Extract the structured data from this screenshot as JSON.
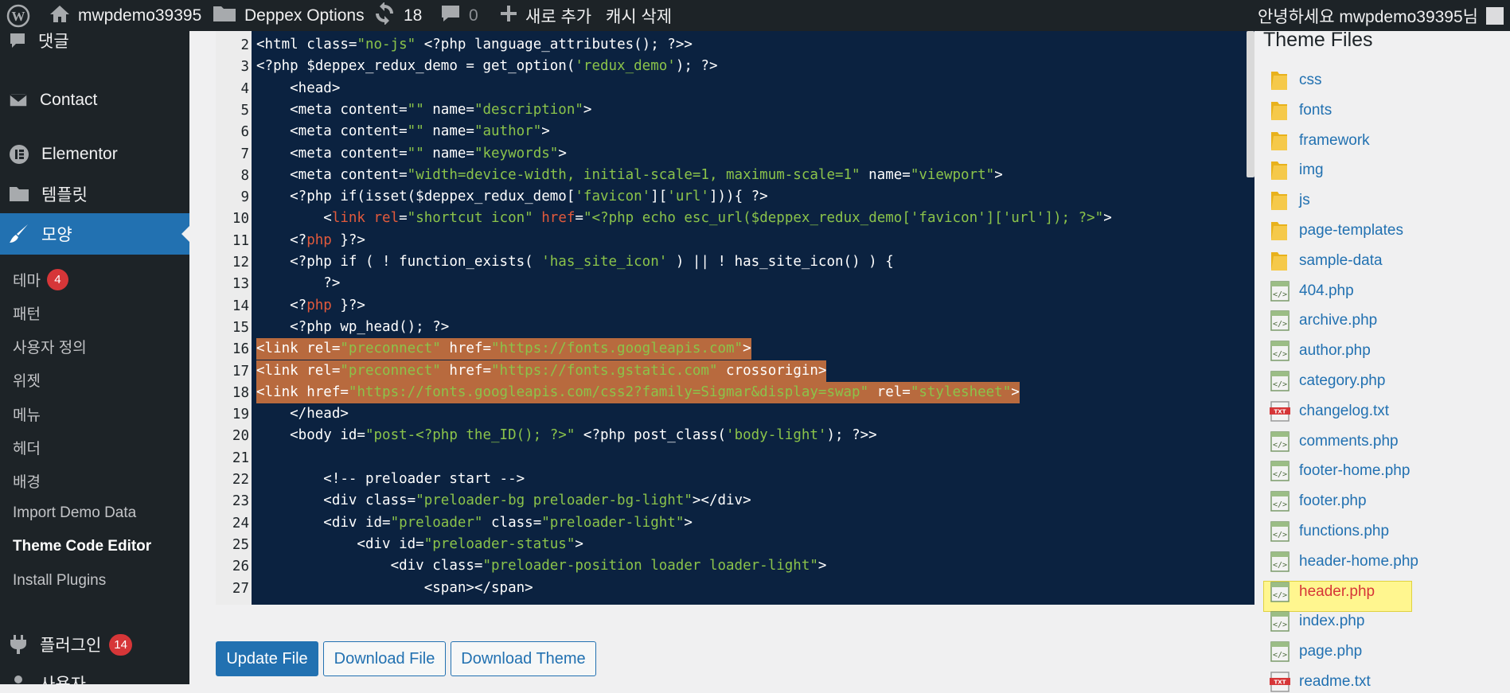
{
  "admin_bar": {
    "site_name": "mwpdemo39395",
    "options_label": "Deppex Options",
    "updates_count": "18",
    "comments_count": "0",
    "new_label": "새로 추가",
    "cache_label": "캐시 삭제",
    "greeting": "안녕하세요 mwpdemo39395님"
  },
  "sidebar": {
    "items": [
      {
        "label": "댓글",
        "icon": "comments-icon"
      },
      {
        "label": "Contact",
        "icon": "mail-icon"
      },
      {
        "label": "Elementor",
        "icon": "elementor-icon"
      },
      {
        "label": "템플릿",
        "icon": "folder-icon"
      },
      {
        "label": "모양",
        "icon": "paintbrush-icon"
      }
    ],
    "submenu": [
      {
        "label": "테마",
        "badge": "4"
      },
      {
        "label": "패턴"
      },
      {
        "label": "사용자 정의"
      },
      {
        "label": "위젯"
      },
      {
        "label": "메뉴"
      },
      {
        "label": "헤더"
      },
      {
        "label": "배경"
      },
      {
        "label": "Import Demo Data"
      },
      {
        "label": "Theme Code Editor"
      },
      {
        "label": "Install Plugins"
      }
    ],
    "after": [
      {
        "label": "플러그인",
        "badge": "14",
        "icon": "plugin-icon"
      },
      {
        "label": "사용자",
        "icon": "user-icon"
      }
    ]
  },
  "editor": {
    "lines": [
      {
        "n": "2",
        "tokens": [
          {
            "t": "<html class="
          },
          {
            "t": "\"no-js\"",
            "c": "s"
          },
          {
            "t": " <?php language_attributes(); ?>>"
          }
        ]
      },
      {
        "n": "3",
        "tokens": [
          {
            "t": "<?php $deppex_redux_demo = get_option("
          },
          {
            "t": "'redux_demo'",
            "c": "s"
          },
          {
            "t": "); ?>"
          }
        ]
      },
      {
        "n": "4",
        "tokens": [
          {
            "t": "    <head>"
          }
        ]
      },
      {
        "n": "5",
        "tokens": [
          {
            "t": "    <meta content="
          },
          {
            "t": "\"\"",
            "c": "s"
          },
          {
            "t": " name="
          },
          {
            "t": "\"description\"",
            "c": "s"
          },
          {
            "t": ">"
          }
        ]
      },
      {
        "n": "6",
        "tokens": [
          {
            "t": "    <meta content="
          },
          {
            "t": "\"\"",
            "c": "s"
          },
          {
            "t": " name="
          },
          {
            "t": "\"author\"",
            "c": "s"
          },
          {
            "t": ">"
          }
        ]
      },
      {
        "n": "7",
        "tokens": [
          {
            "t": "    <meta content="
          },
          {
            "t": "\"\"",
            "c": "s"
          },
          {
            "t": " name="
          },
          {
            "t": "\"keywords\"",
            "c": "s"
          },
          {
            "t": ">"
          }
        ]
      },
      {
        "n": "8",
        "tokens": [
          {
            "t": "    <meta content="
          },
          {
            "t": "\"width=device-width, initial-scale=1, maximum-scale=1\"",
            "c": "s"
          },
          {
            "t": " name="
          },
          {
            "t": "\"viewport\"",
            "c": "s"
          },
          {
            "t": ">"
          }
        ]
      },
      {
        "n": "9",
        "tokens": [
          {
            "t": "    <?php if(isset($deppex_redux_demo["
          },
          {
            "t": "'favicon'",
            "c": "s"
          },
          {
            "t": "]["
          },
          {
            "t": "'url'",
            "c": "s"
          },
          {
            "t": "])){ ?>"
          }
        ]
      },
      {
        "n": "10",
        "tokens": [
          {
            "t": "        <"
          },
          {
            "t": "link rel",
            "c": "k"
          },
          {
            "t": "="
          },
          {
            "t": "\"shortcut icon\"",
            "c": "s"
          },
          {
            "t": " "
          },
          {
            "t": "href",
            "c": "k"
          },
          {
            "t": "="
          },
          {
            "t": "\"<?php echo esc_url($deppex_redux_demo['favicon']['url']); ?>\"",
            "c": "s"
          },
          {
            "t": ">"
          }
        ]
      },
      {
        "n": "11",
        "tokens": [
          {
            "t": "    <?"
          },
          {
            "t": "php",
            "c": "k"
          },
          {
            "t": " }?>"
          }
        ]
      },
      {
        "n": "12",
        "tokens": [
          {
            "t": "    <?php if ( ! function_exists( "
          },
          {
            "t": "'has_site_icon'",
            "c": "s"
          },
          {
            "t": " ) || ! has_site_icon() ) {"
          }
        ]
      },
      {
        "n": "13",
        "tokens": [
          {
            "t": "        ?>"
          }
        ]
      },
      {
        "n": "14",
        "tokens": [
          {
            "t": "    <?"
          },
          {
            "t": "php",
            "c": "k"
          },
          {
            "t": " }?>"
          }
        ]
      },
      {
        "n": "15",
        "tokens": [
          {
            "t": "    <?php wp_head(); ?>"
          }
        ]
      },
      {
        "n": "16",
        "hl": true,
        "tokens": [
          {
            "t": "<link rel="
          },
          {
            "t": "\"preconnect\"",
            "c": "s"
          },
          {
            "t": " href="
          },
          {
            "t": "\"https://fonts.googleapis.com\"",
            "c": "s"
          },
          {
            "t": ">"
          }
        ]
      },
      {
        "n": "17",
        "hl": true,
        "tokens": [
          {
            "t": "<link rel="
          },
          {
            "t": "\"preconnect\"",
            "c": "s"
          },
          {
            "t": " href="
          },
          {
            "t": "\"https://fonts.gstatic.com\"",
            "c": "s"
          },
          {
            "t": " crossorigin>"
          }
        ]
      },
      {
        "n": "18",
        "hl": true,
        "tokens": [
          {
            "t": "<link href="
          },
          {
            "t": "\"https://fonts.googleapis.com/css2?family=Sigmar&display=swap\"",
            "c": "s"
          },
          {
            "t": " rel="
          },
          {
            "t": "\"stylesheet\"",
            "c": "s"
          },
          {
            "t": ">"
          }
        ]
      },
      {
        "n": "19",
        "tokens": [
          {
            "t": "    </head>"
          }
        ]
      },
      {
        "n": "20",
        "tokens": [
          {
            "t": "    <body id="
          },
          {
            "t": "\"post-<?php the_ID(); ?>\"",
            "c": "s"
          },
          {
            "t": " <?php post_class("
          },
          {
            "t": "'body-light'",
            "c": "s"
          },
          {
            "t": "); ?>>"
          }
        ]
      },
      {
        "n": "21",
        "tokens": []
      },
      {
        "n": "22",
        "tokens": [
          {
            "t": "        <!-- preloader start -->"
          }
        ]
      },
      {
        "n": "23",
        "tokens": [
          {
            "t": "        <div class="
          },
          {
            "t": "\"preloader-bg preloader-bg-light\"",
            "c": "s"
          },
          {
            "t": "></div>"
          }
        ]
      },
      {
        "n": "24",
        "tokens": [
          {
            "t": "        <div id="
          },
          {
            "t": "\"preloader\"",
            "c": "s"
          },
          {
            "t": " class="
          },
          {
            "t": "\"preloader-light\"",
            "c": "s"
          },
          {
            "t": ">"
          }
        ]
      },
      {
        "n": "25",
        "tokens": [
          {
            "t": "            <div id="
          },
          {
            "t": "\"preloader-status\"",
            "c": "s"
          },
          {
            "t": ">"
          }
        ]
      },
      {
        "n": "26",
        "tokens": [
          {
            "t": "                <div class="
          },
          {
            "t": "\"preloader-position loader loader-light\"",
            "c": "s"
          },
          {
            "t": ">"
          }
        ]
      },
      {
        "n": "27",
        "tokens": [
          {
            "t": "                    <span></span>"
          }
        ]
      }
    ]
  },
  "buttons": {
    "update": "Update File",
    "download_file": "Download File",
    "download_theme": "Download Theme"
  },
  "theme_files": {
    "title": "Theme Files",
    "files": [
      {
        "name": "css",
        "type": "folder"
      },
      {
        "name": "fonts",
        "type": "folder"
      },
      {
        "name": "framework",
        "type": "folder"
      },
      {
        "name": "img",
        "type": "folder"
      },
      {
        "name": "js",
        "type": "folder"
      },
      {
        "name": "page-templates",
        "type": "folder"
      },
      {
        "name": "sample-data",
        "type": "folder"
      },
      {
        "name": "404.php",
        "type": "php"
      },
      {
        "name": "archive.php",
        "type": "php"
      },
      {
        "name": "author.php",
        "type": "php"
      },
      {
        "name": "category.php",
        "type": "php"
      },
      {
        "name": "changelog.txt",
        "type": "txt"
      },
      {
        "name": "comments.php",
        "type": "php"
      },
      {
        "name": "footer-home.php",
        "type": "php"
      },
      {
        "name": "footer.php",
        "type": "php"
      },
      {
        "name": "functions.php",
        "type": "php"
      },
      {
        "name": "header-home.php",
        "type": "php"
      },
      {
        "name": "header.php",
        "type": "php",
        "current": true
      },
      {
        "name": "index.php",
        "type": "php"
      },
      {
        "name": "page.php",
        "type": "php"
      },
      {
        "name": "readme.txt",
        "type": "txt"
      }
    ]
  },
  "colors": {
    "admin_bar": "#1d2327",
    "accent": "#2271b1",
    "editor_bg": "#0b2240",
    "code_string": "#8bc34a",
    "code_keyword": "#e25a3c",
    "highlight": "#b86a3e",
    "badge": "#d63638"
  }
}
